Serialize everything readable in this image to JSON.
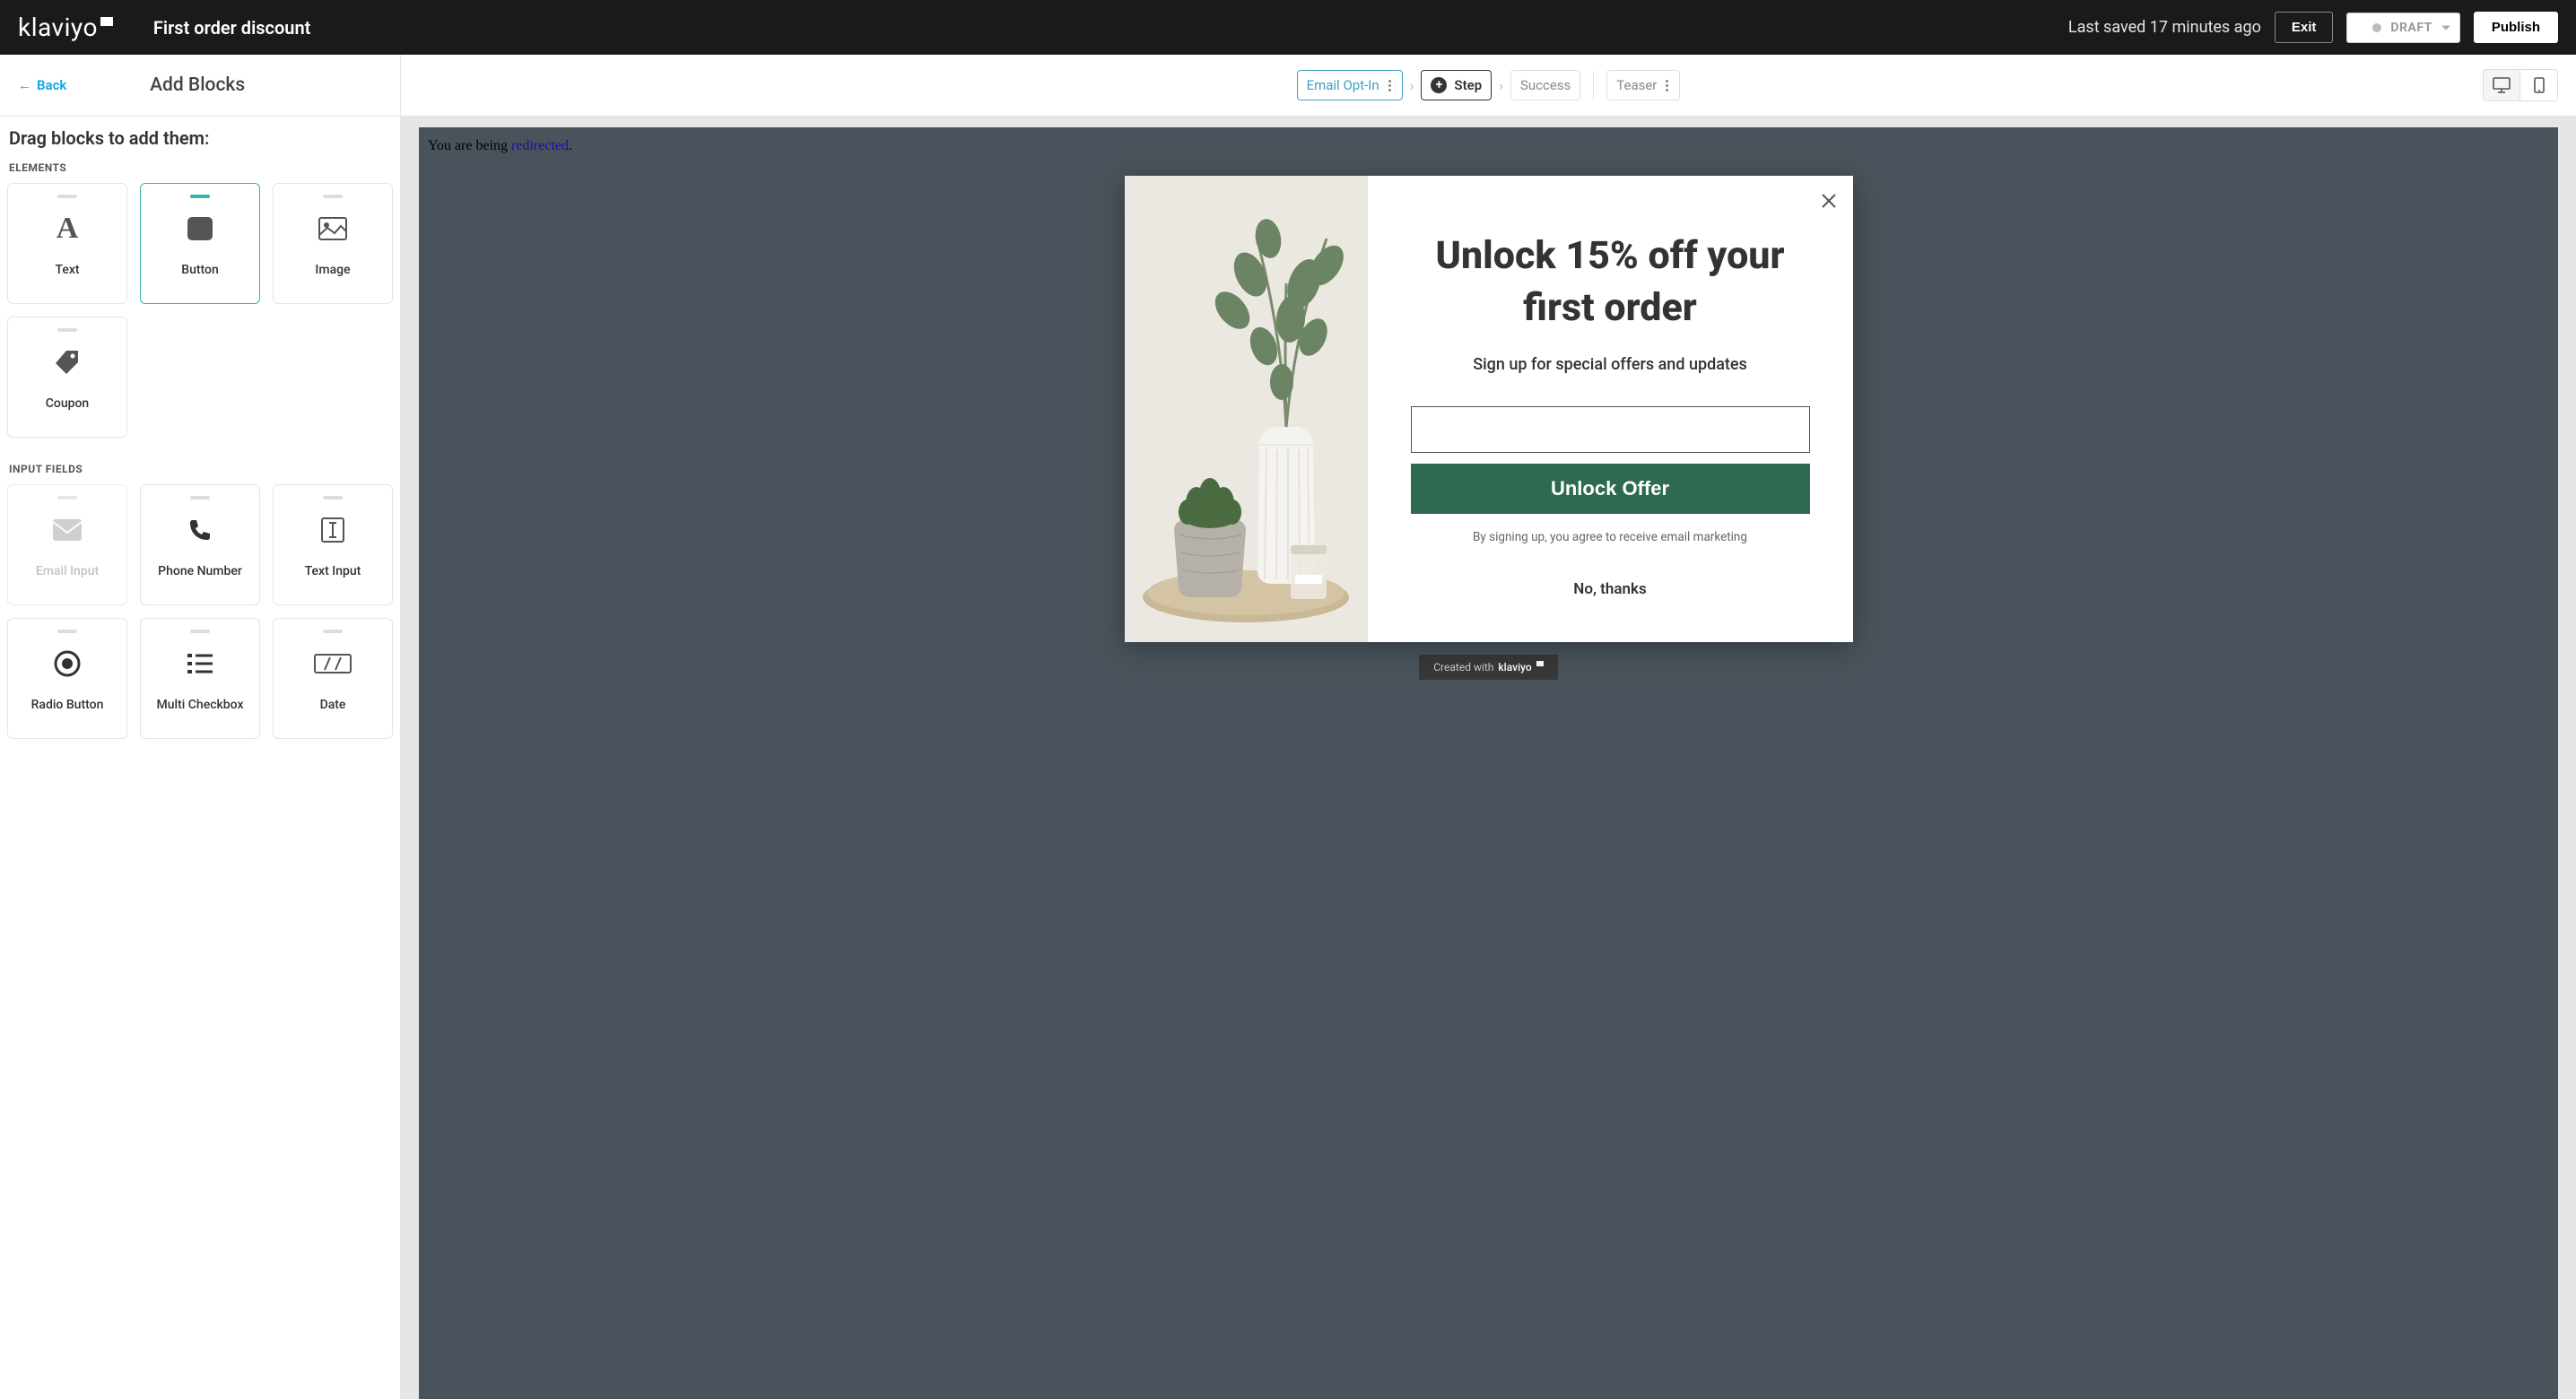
{
  "topbar": {
    "logo": "klaviyo",
    "title": "First order discount",
    "saved_text": "Last saved 17 minutes ago",
    "exit_label": "Exit",
    "draft_label": "DRAFT",
    "publish_label": "Publish"
  },
  "subheader": {
    "back_label": "Back",
    "panel_title": "Add Blocks",
    "steps": {
      "email_optin": "Email Opt-In",
      "step": "Step",
      "success": "Success",
      "teaser": "Teaser"
    }
  },
  "sidebar": {
    "instruction": "Drag blocks to add them:",
    "sections": {
      "elements": "ELEMENTS",
      "input_fields": "INPUT FIELDS"
    },
    "blocks": {
      "text": "Text",
      "button": "Button",
      "image": "Image",
      "coupon": "Coupon",
      "email_input": "Email Input",
      "phone_number": "Phone Number",
      "text_input": "Text Input",
      "radio_button": "Radio Button",
      "multi_checkbox": "Multi Checkbox",
      "date": "Date"
    }
  },
  "preview": {
    "redirect_prefix": "You are being ",
    "redirect_link": "redirected",
    "popup": {
      "heading": "Unlock 15% off your first order",
      "subheading": "Sign up for special offers and updates",
      "cta": "Unlock Offer",
      "disclaimer": "By signing up, you agree to receive email marketing",
      "dismiss": "No, thanks"
    },
    "credit": "Created with",
    "credit_brand": "klaviyo"
  }
}
